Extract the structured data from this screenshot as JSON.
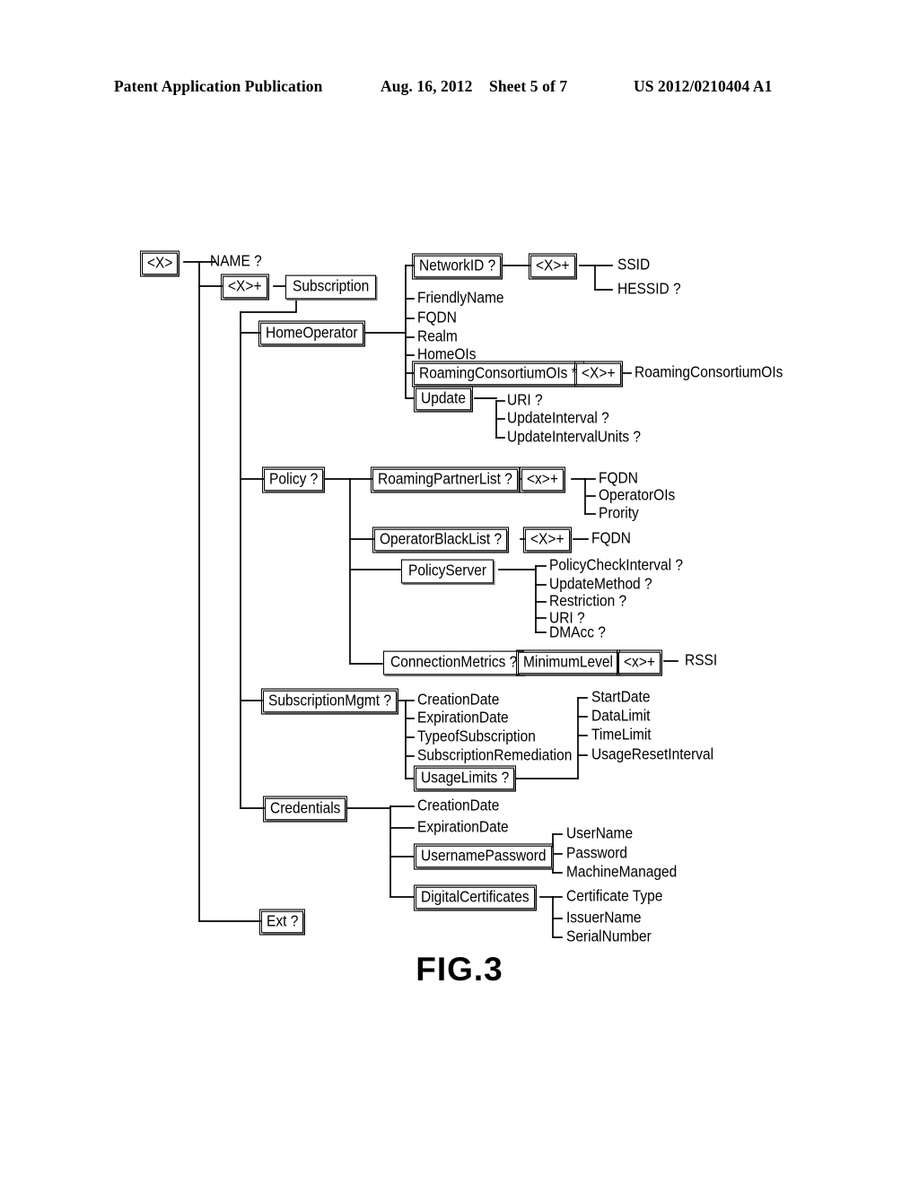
{
  "header": {
    "publication": "Patent Application Publication",
    "date": "Aug. 16, 2012",
    "sheet": "Sheet 5 of 7",
    "number": "US 2012/0210404 A1"
  },
  "figure": {
    "label": "FIG.3",
    "title": "Subscription management object tree"
  },
  "nodes": {
    "root": "<X>",
    "name": "NAME  ?",
    "x_plus_sub": "<X>+",
    "subscription": "Subscription",
    "home_operator": "HomeOperator",
    "network_id": "NetworkID  ?",
    "x_plus_net": "<X>+",
    "ssid": "SSID",
    "hessid": "HESSID  ?",
    "friendly_name": "FriendlyName",
    "fqdn_home": "FQDN",
    "realm": "Realm",
    "home_ois": "HomeOIs",
    "roaming_consortium_ois_star": "RoamingConsortiumOIs  *",
    "x_plus_rc": "<X>+",
    "roaming_consortium_ois": "RoamingConsortiumOIs",
    "update": "Update",
    "uri_update": "URI  ?",
    "update_interval": "UpdateInterval  ?",
    "update_interval_units": "UpdateIntervalUnits  ?",
    "policy": "Policy  ?",
    "roaming_partner_list": "RoamingPartnerList  ?",
    "x_plus_rpl": "<x>+",
    "fqdn_rpl": "FQDN",
    "operator_ois": "OperatorOIs",
    "prority": "Prority",
    "operator_black_list": "OperatorBlackList  ?",
    "x_plus_obl": "<X>+",
    "fqdn_obl": "FQDN",
    "policy_server": "PolicyServer",
    "policy_check_interval": "PolicyCheckInterval  ?",
    "update_method": "UpdateMethod  ?",
    "restriction": "Restriction  ?",
    "uri_ps": "URI  ?",
    "dmacc": "DMAcc  ?",
    "connection_metrics": "ConnectionMetrics  ?",
    "minimum_level": "MinimumLevel",
    "x_plus_ml": "<x>+",
    "rssi": "RSSI",
    "subscription_mgmt": "SubscriptionMgmt  ?",
    "creation_date_sm": "CreationDate",
    "expiration_date_sm": "ExpirationDate",
    "type_of_subscription": "TypeofSubscription",
    "subscription_remediation": "SubscriptionRemediation",
    "usage_limits": "UsageLimits  ?",
    "start_date": "StartDate",
    "data_limit": "DataLimit",
    "time_limit": "TimeLimit",
    "usage_reset_interval": "UsageResetInterval",
    "credentials": "Credentials",
    "creation_date_cr": "CreationDate",
    "expiration_date_cr": "ExpirationDate",
    "username_password": "UsernamePassword",
    "user_name": "UserName",
    "password": "Password",
    "machine_managed": "MachineManaged",
    "digital_certificates": "DigitalCertificates",
    "certificate_type": "Certificate  Type",
    "issuer_name": "IssuerName",
    "serial_number": "SerialNumber",
    "ext": "Ext  ?"
  },
  "colors": {
    "ink": "#000000",
    "paper": "#ffffff",
    "shadow": "#808080"
  }
}
